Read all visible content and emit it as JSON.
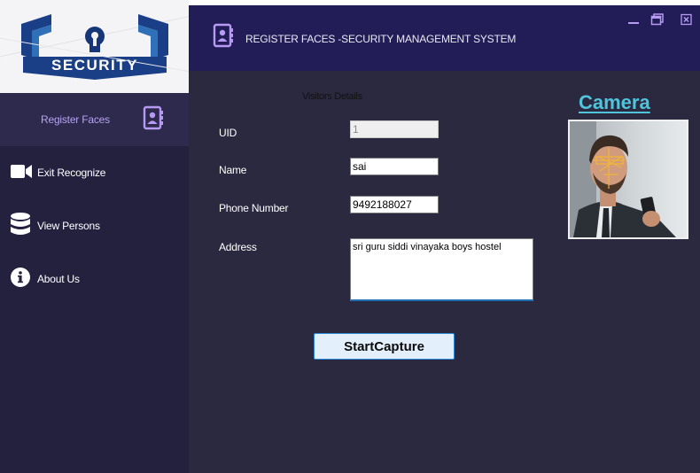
{
  "logo": {
    "text": "SECURITY",
    "colors": {
      "primary": "#1b3f86",
      "secondary": "#2f70b8"
    }
  },
  "sidebar": {
    "items": [
      {
        "label": "Register Faces",
        "icon": "contact-book-icon",
        "active": true
      },
      {
        "label": "Exit Recognize",
        "icon": "video-camera-icon",
        "active": false
      },
      {
        "label": "View Persons",
        "icon": "database-icon",
        "active": false
      },
      {
        "label": "About Us",
        "icon": "info-icon",
        "active": false
      }
    ]
  },
  "header": {
    "title": "REGISTER FACES -SECURITY MANAGEMENT SYSTEM",
    "icon": "contact-book-icon",
    "window_controls": [
      "minimize-icon",
      "maximize-icon",
      "close-icon"
    ]
  },
  "form": {
    "section_title": "Visitors Details",
    "fields": {
      "uid": {
        "label": "UID",
        "value": "1"
      },
      "name": {
        "label": "Name",
        "value": "sai"
      },
      "phone": {
        "label": "Phone Number",
        "value": "9492188027"
      },
      "address": {
        "label": "Address",
        "value": "sri guru siddi vinayaka boys hostel"
      }
    },
    "submit_label": "StartCapture"
  },
  "camera": {
    "title": "Camera"
  },
  "colors": {
    "sidebar_bg": "#24213f",
    "sidebar_active_bg": "#2d2a4d",
    "active_text": "#b7a3f1",
    "header_bg": "#221d57",
    "main_bg": "#2b2940",
    "accent_cyan": "#4fc4db",
    "icon_purple": "#b79af3",
    "button_border": "#2b87d8"
  }
}
